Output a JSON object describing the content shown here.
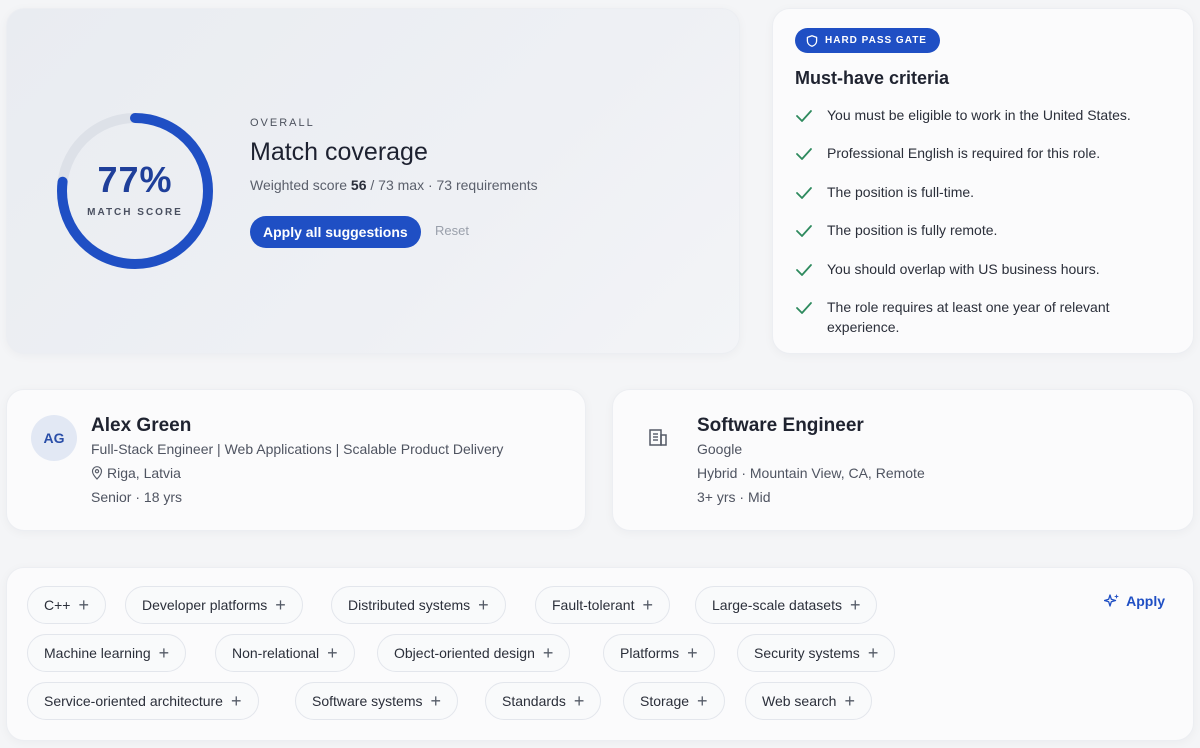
{
  "match": {
    "score_percent": 77,
    "score_label": "77%",
    "ring_caption": "MATCH SCORE",
    "eyebrow": "OVERALL",
    "title": "Match coverage",
    "weighted_prefix": "Weighted score",
    "weighted_value": "56",
    "weighted_suffix": "/ 73 max · 73 requirements",
    "apply_all_label": "Apply all suggestions",
    "reset_label": "Reset",
    "accent_color": "#1f4fc4"
  },
  "criteria": {
    "badge": "HARD PASS GATE",
    "title": "Must-have criteria",
    "items": [
      "You must be eligible to work in the United States.",
      "Professional English is required for this role.",
      "The position is full-time.",
      "The position is fully remote.",
      "You should overlap with US business hours.",
      "The role requires at least one year of relevant experience."
    ],
    "check_color": "#2e8a5e"
  },
  "candidate": {
    "initials": "AG",
    "name": "Alex Green",
    "headline": "Full-Stack Engineer | Web Applications | Scalable Product Delivery",
    "location": "Riga, Latvia",
    "seniority": "Senior · 18 yrs"
  },
  "job": {
    "title": "Software Engineer",
    "company": "Google",
    "location": "Hybrid · Mountain View, CA, Remote",
    "experience": "3+ yrs · Mid"
  },
  "skills": {
    "apply_label": "Apply",
    "chips": [
      "C++",
      "Developer platforms",
      "Distributed systems",
      "Fault-tolerant",
      "Large-scale datasets",
      "Machine learning",
      "Non-relational",
      "Object-oriented design",
      "Platforms",
      "Security systems",
      "Service-oriented architecture",
      "Software systems",
      "Standards",
      "Storage",
      "Web search"
    ]
  }
}
